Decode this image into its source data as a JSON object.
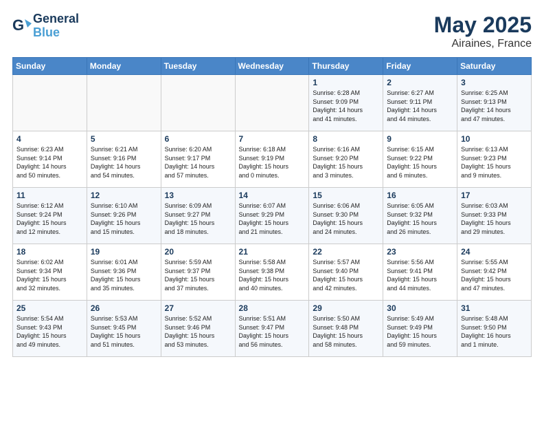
{
  "header": {
    "logo_line1": "General",
    "logo_line2": "Blue",
    "month_year": "May 2025",
    "location": "Airaines, France"
  },
  "weekdays": [
    "Sunday",
    "Monday",
    "Tuesday",
    "Wednesday",
    "Thursday",
    "Friday",
    "Saturday"
  ],
  "weeks": [
    [
      {
        "day": "",
        "content": ""
      },
      {
        "day": "",
        "content": ""
      },
      {
        "day": "",
        "content": ""
      },
      {
        "day": "",
        "content": ""
      },
      {
        "day": "1",
        "content": "Sunrise: 6:28 AM\nSunset: 9:09 PM\nDaylight: 14 hours\nand 41 minutes."
      },
      {
        "day": "2",
        "content": "Sunrise: 6:27 AM\nSunset: 9:11 PM\nDaylight: 14 hours\nand 44 minutes."
      },
      {
        "day": "3",
        "content": "Sunrise: 6:25 AM\nSunset: 9:13 PM\nDaylight: 14 hours\nand 47 minutes."
      }
    ],
    [
      {
        "day": "4",
        "content": "Sunrise: 6:23 AM\nSunset: 9:14 PM\nDaylight: 14 hours\nand 50 minutes."
      },
      {
        "day": "5",
        "content": "Sunrise: 6:21 AM\nSunset: 9:16 PM\nDaylight: 14 hours\nand 54 minutes."
      },
      {
        "day": "6",
        "content": "Sunrise: 6:20 AM\nSunset: 9:17 PM\nDaylight: 14 hours\nand 57 minutes."
      },
      {
        "day": "7",
        "content": "Sunrise: 6:18 AM\nSunset: 9:19 PM\nDaylight: 15 hours\nand 0 minutes."
      },
      {
        "day": "8",
        "content": "Sunrise: 6:16 AM\nSunset: 9:20 PM\nDaylight: 15 hours\nand 3 minutes."
      },
      {
        "day": "9",
        "content": "Sunrise: 6:15 AM\nSunset: 9:22 PM\nDaylight: 15 hours\nand 6 minutes."
      },
      {
        "day": "10",
        "content": "Sunrise: 6:13 AM\nSunset: 9:23 PM\nDaylight: 15 hours\nand 9 minutes."
      }
    ],
    [
      {
        "day": "11",
        "content": "Sunrise: 6:12 AM\nSunset: 9:24 PM\nDaylight: 15 hours\nand 12 minutes."
      },
      {
        "day": "12",
        "content": "Sunrise: 6:10 AM\nSunset: 9:26 PM\nDaylight: 15 hours\nand 15 minutes."
      },
      {
        "day": "13",
        "content": "Sunrise: 6:09 AM\nSunset: 9:27 PM\nDaylight: 15 hours\nand 18 minutes."
      },
      {
        "day": "14",
        "content": "Sunrise: 6:07 AM\nSunset: 9:29 PM\nDaylight: 15 hours\nand 21 minutes."
      },
      {
        "day": "15",
        "content": "Sunrise: 6:06 AM\nSunset: 9:30 PM\nDaylight: 15 hours\nand 24 minutes."
      },
      {
        "day": "16",
        "content": "Sunrise: 6:05 AM\nSunset: 9:32 PM\nDaylight: 15 hours\nand 26 minutes."
      },
      {
        "day": "17",
        "content": "Sunrise: 6:03 AM\nSunset: 9:33 PM\nDaylight: 15 hours\nand 29 minutes."
      }
    ],
    [
      {
        "day": "18",
        "content": "Sunrise: 6:02 AM\nSunset: 9:34 PM\nDaylight: 15 hours\nand 32 minutes."
      },
      {
        "day": "19",
        "content": "Sunrise: 6:01 AM\nSunset: 9:36 PM\nDaylight: 15 hours\nand 35 minutes."
      },
      {
        "day": "20",
        "content": "Sunrise: 5:59 AM\nSunset: 9:37 PM\nDaylight: 15 hours\nand 37 minutes."
      },
      {
        "day": "21",
        "content": "Sunrise: 5:58 AM\nSunset: 9:38 PM\nDaylight: 15 hours\nand 40 minutes."
      },
      {
        "day": "22",
        "content": "Sunrise: 5:57 AM\nSunset: 9:40 PM\nDaylight: 15 hours\nand 42 minutes."
      },
      {
        "day": "23",
        "content": "Sunrise: 5:56 AM\nSunset: 9:41 PM\nDaylight: 15 hours\nand 44 minutes."
      },
      {
        "day": "24",
        "content": "Sunrise: 5:55 AM\nSunset: 9:42 PM\nDaylight: 15 hours\nand 47 minutes."
      }
    ],
    [
      {
        "day": "25",
        "content": "Sunrise: 5:54 AM\nSunset: 9:43 PM\nDaylight: 15 hours\nand 49 minutes."
      },
      {
        "day": "26",
        "content": "Sunrise: 5:53 AM\nSunset: 9:45 PM\nDaylight: 15 hours\nand 51 minutes."
      },
      {
        "day": "27",
        "content": "Sunrise: 5:52 AM\nSunset: 9:46 PM\nDaylight: 15 hours\nand 53 minutes."
      },
      {
        "day": "28",
        "content": "Sunrise: 5:51 AM\nSunset: 9:47 PM\nDaylight: 15 hours\nand 56 minutes."
      },
      {
        "day": "29",
        "content": "Sunrise: 5:50 AM\nSunset: 9:48 PM\nDaylight: 15 hours\nand 58 minutes."
      },
      {
        "day": "30",
        "content": "Sunrise: 5:49 AM\nSunset: 9:49 PM\nDaylight: 15 hours\nand 59 minutes."
      },
      {
        "day": "31",
        "content": "Sunrise: 5:48 AM\nSunset: 9:50 PM\nDaylight: 16 hours\nand 1 minute."
      }
    ]
  ]
}
